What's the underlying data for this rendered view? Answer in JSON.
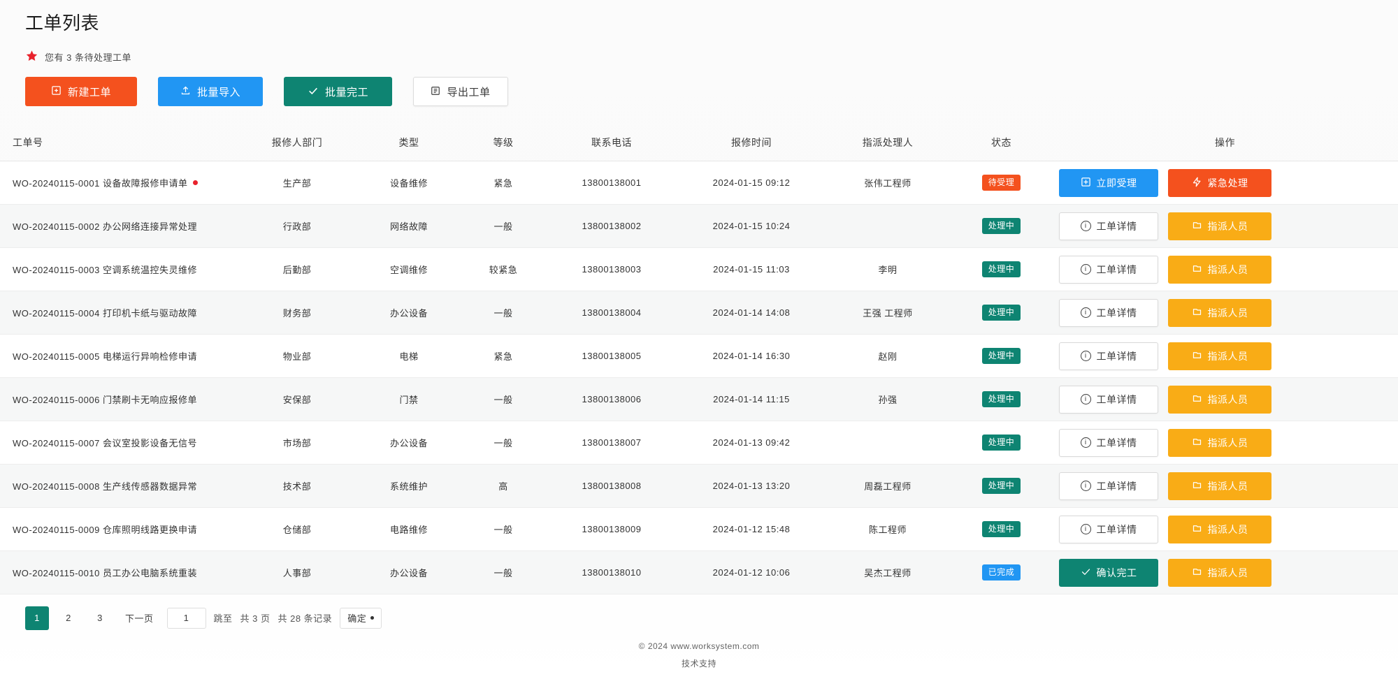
{
  "header": {
    "title": "工单列表",
    "notice": {
      "icon": "alert-star-icon",
      "text": "您有 3 条待处理工单"
    }
  },
  "toolbar": {
    "buttons": [
      {
        "label": "新建工单",
        "icon": "plus-square-icon",
        "style": "primary",
        "color": "#f4511e"
      },
      {
        "label": "批量导入",
        "icon": "upload-icon",
        "style": "info",
        "color": "#2196f3"
      },
      {
        "label": "批量完工",
        "icon": "check-icon",
        "style": "success",
        "color": "#0e8472"
      },
      {
        "label": "导出工单",
        "icon": "export-icon",
        "style": "ghost",
        "color": "#ffffff"
      }
    ]
  },
  "table": {
    "columns": [
      {
        "key": "order",
        "label": "工单号"
      },
      {
        "key": "dept",
        "label": "报修人部门"
      },
      {
        "key": "type",
        "label": "类型"
      },
      {
        "key": "level",
        "label": "等级"
      },
      {
        "key": "phone",
        "label": "联系电话"
      },
      {
        "key": "time",
        "label": "报修时间"
      },
      {
        "key": "person",
        "label": "指派处理人"
      },
      {
        "key": "status",
        "label": "状态"
      },
      {
        "key": "actions",
        "label": "操作"
      }
    ],
    "rows": [
      {
        "order": "WO-20240115-0001 设备故障报修申请单",
        "new": true,
        "dept": "生产部",
        "type": "设备维修",
        "level": "紧急",
        "phone": "13800138001",
        "time": "2024-01-15 09:12",
        "person": "张伟工程师",
        "status": {
          "label": "待受理",
          "color": "red"
        },
        "actions": [
          {
            "label": "立即受理",
            "icon": "claim-icon",
            "style": "blue"
          },
          {
            "label": "紧急处理",
            "icon": "flash-icon",
            "style": "red"
          }
        ]
      },
      {
        "order": "WO-20240115-0002 办公网络连接异常处理",
        "new": false,
        "dept": "行政部",
        "type": "网络故障",
        "level": "一般",
        "phone": "13800138002",
        "time": "2024-01-15 10:24",
        "person": "",
        "status": {
          "label": "处理中",
          "color": "teal"
        },
        "actions": [
          {
            "label": "工单详情",
            "icon": "info-circle-icon",
            "style": "ghost"
          },
          {
            "label": "指派人员",
            "icon": "assign-icon",
            "style": "amber"
          }
        ]
      },
      {
        "order": "WO-20240115-0003 空调系统温控失灵维修",
        "new": false,
        "dept": "后勤部",
        "type": "空调维修",
        "level": "较紧急",
        "phone": "13800138003",
        "time": "2024-01-15 11:03",
        "person": "李明",
        "status": {
          "label": "处理中",
          "color": "teal"
        },
        "actions": [
          {
            "label": "工单详情",
            "icon": "info-circle-icon",
            "style": "ghost"
          },
          {
            "label": "指派人员",
            "icon": "assign-icon",
            "style": "amber"
          }
        ]
      },
      {
        "order": "WO-20240115-0004 打印机卡纸与驱动故障",
        "new": false,
        "dept": "财务部",
        "type": "办公设备",
        "level": "一般",
        "phone": "13800138004",
        "time": "2024-01-14 14:08",
        "person": "王强 工程师",
        "status": {
          "label": "处理中",
          "color": "teal"
        },
        "actions": [
          {
            "label": "工单详情",
            "icon": "info-circle-icon",
            "style": "ghost"
          },
          {
            "label": "指派人员",
            "icon": "assign-icon",
            "style": "amber"
          }
        ]
      },
      {
        "order": "WO-20240115-0005 电梯运行异响检修申请",
        "new": false,
        "dept": "物业部",
        "type": "电梯",
        "level": "紧急",
        "phone": "13800138005",
        "time": "2024-01-14 16:30",
        "person": "赵刚",
        "status": {
          "label": "处理中",
          "color": "teal"
        },
        "actions": [
          {
            "label": "工单详情",
            "icon": "info-circle-icon",
            "style": "ghost"
          },
          {
            "label": "指派人员",
            "icon": "assign-icon",
            "style": "amber"
          }
        ]
      },
      {
        "order": "WO-20240115-0006 门禁刷卡无响应报修单",
        "new": false,
        "dept": "安保部",
        "type": "门禁",
        "level": "一般",
        "phone": "13800138006",
        "time": "2024-01-14 11:15",
        "person": "孙强",
        "status": {
          "label": "处理中",
          "color": "teal"
        },
        "actions": [
          {
            "label": "工单详情",
            "icon": "info-circle-icon",
            "style": "ghost"
          },
          {
            "label": "指派人员",
            "icon": "assign-icon",
            "style": "amber"
          }
        ]
      },
      {
        "order": "WO-20240115-0007 会议室投影设备无信号",
        "new": false,
        "dept": "市场部",
        "type": "办公设备",
        "level": "一般",
        "phone": "13800138007",
        "time": "2024-01-13 09:42",
        "person": "",
        "status": {
          "label": "处理中",
          "color": "teal"
        },
        "actions": [
          {
            "label": "工单详情",
            "icon": "info-circle-icon",
            "style": "ghost"
          },
          {
            "label": "指派人员",
            "icon": "assign-icon",
            "style": "amber"
          }
        ]
      },
      {
        "order": "WO-20240115-0008 生产线传感器数据异常",
        "new": false,
        "dept": "技术部",
        "type": "系统维护",
        "level": "高",
        "phone": "13800138008",
        "time": "2024-01-13 13:20",
        "person": "周磊工程师",
        "status": {
          "label": "处理中",
          "color": "teal"
        },
        "actions": [
          {
            "label": "工单详情",
            "icon": "info-circle-icon",
            "style": "ghost"
          },
          {
            "label": "指派人员",
            "icon": "assign-icon",
            "style": "amber"
          }
        ]
      },
      {
        "order": "WO-20240115-0009 仓库照明线路更换申请",
        "new": false,
        "dept": "仓储部",
        "type": "电路维修",
        "level": "一般",
        "phone": "13800138009",
        "time": "2024-01-12 15:48",
        "person": "陈工程师",
        "status": {
          "label": "处理中",
          "color": "teal"
        },
        "actions": [
          {
            "label": "工单详情",
            "icon": "info-circle-icon",
            "style": "ghost"
          },
          {
            "label": "指派人员",
            "icon": "assign-icon",
            "style": "amber"
          }
        ]
      },
      {
        "order": "WO-20240115-0010 员工办公电脑系统重装",
        "new": false,
        "dept": "人事部",
        "type": "办公设备",
        "level": "一般",
        "phone": "13800138010",
        "time": "2024-01-12 10:06",
        "person": "吴杰工程师",
        "status": {
          "label": "已完成",
          "color": "blue"
        },
        "actions": [
          {
            "label": "确认完工",
            "icon": "check-icon",
            "style": "teal"
          },
          {
            "label": "指派人员",
            "icon": "assign-icon",
            "style": "amber"
          }
        ]
      }
    ]
  },
  "pagination": {
    "pages": [
      "1",
      "2",
      "3",
      "下一页"
    ],
    "current_page": "1",
    "jump_value": "1",
    "jump_label": "跳至",
    "total_label": "共 3 页",
    "total_records": "共 28 条记录",
    "go_label": "确定"
  },
  "footer": {
    "copyright": "© 2024  www.worksystem.com",
    "line2": "技术支持"
  },
  "colors": {
    "primary_orange": "#f4511e",
    "blue": "#2196f3",
    "teal": "#0e8472",
    "amber": "#f9ac16",
    "alert_red": "#e8222c",
    "row_alt": "#f6f7f7"
  }
}
